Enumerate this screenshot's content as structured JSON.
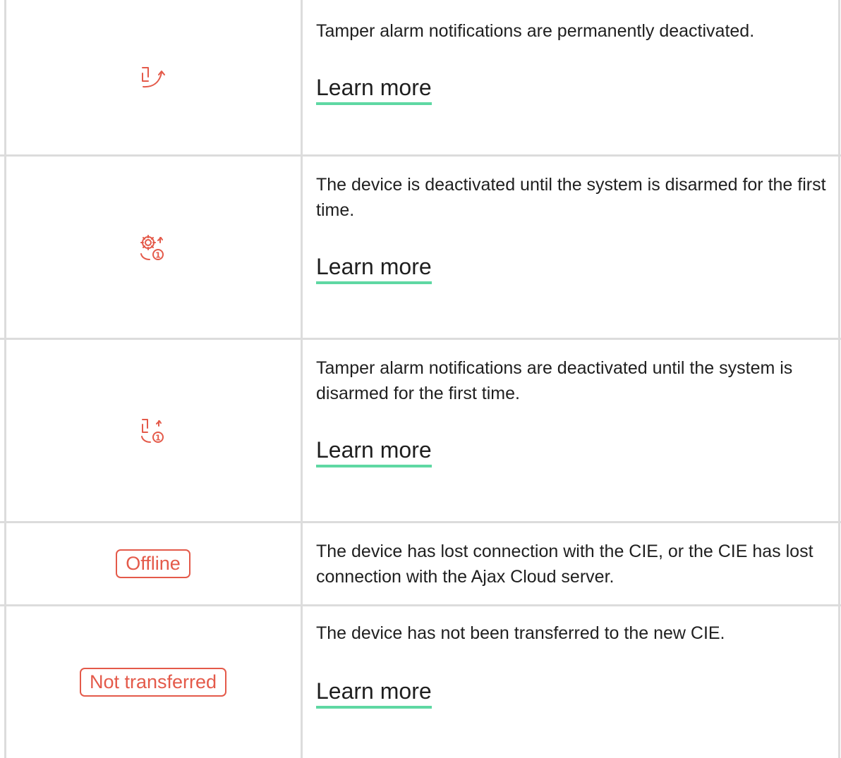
{
  "colors": {
    "accent_red": "#e45a4a",
    "link_underline": "#5fd8a3",
    "border": "#dcdcdc",
    "text": "#1f1f1f"
  },
  "rows": [
    {
      "icon": "tamper-deactivated-icon",
      "description": "Tamper alarm notifications are permanently deactivated.",
      "link": "Learn more"
    },
    {
      "icon": "device-deactivated-until-disarm-icon",
      "description": "The device is deactivated until the system is disarmed for the first time.",
      "link": "Learn more"
    },
    {
      "icon": "tamper-deactivated-until-disarm-icon",
      "description": "Tamper alarm notifications are deactivated until the system is disarmed for the first time.",
      "link": "Learn more"
    },
    {
      "badge": "Offline",
      "description": "The device has lost connection with the CIE, or the CIE has lost connection with the Ajax Cloud server."
    },
    {
      "badge": "Not transferred",
      "description": "The device has not been transferred to the new CIE.",
      "link": "Learn more"
    }
  ]
}
